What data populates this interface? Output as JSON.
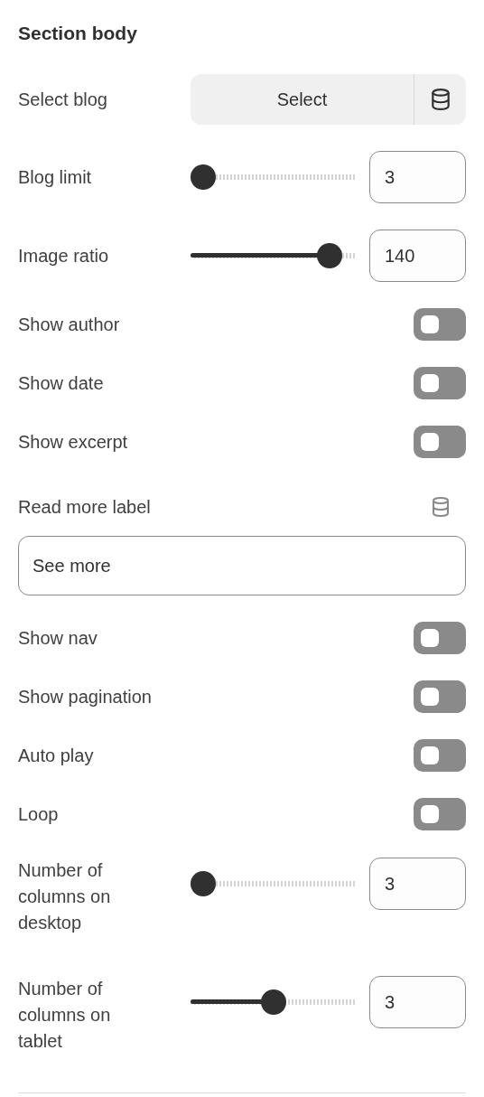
{
  "section_title": "Section body",
  "settings": [
    {
      "kind": "select",
      "label": "Select blog",
      "button": "Select"
    },
    {
      "kind": "slider",
      "label": "Blog limit",
      "level": 0,
      "value": "3"
    },
    {
      "kind": "slider",
      "label": "Image ratio",
      "level": 0.9,
      "value": "140"
    },
    {
      "kind": "toggle",
      "label": "Show author",
      "on": false
    },
    {
      "kind": "toggle",
      "label": "Show date",
      "on": false
    },
    {
      "kind": "toggle",
      "label": "Show excerpt",
      "on": false
    },
    {
      "kind": "text",
      "label": "Read more label",
      "value": "See more"
    },
    {
      "kind": "toggle",
      "label": "Show nav",
      "on": false
    },
    {
      "kind": "toggle",
      "label": "Show pagination",
      "on": false
    },
    {
      "kind": "toggle",
      "label": "Auto play",
      "on": false
    },
    {
      "kind": "toggle",
      "label": "Loop",
      "on": false
    },
    {
      "kind": "slider",
      "label": "Number of columns on desktop",
      "level": 0,
      "value": "3"
    },
    {
      "kind": "slider",
      "label": "Number of columns on tablet",
      "level": 0.5,
      "value": "3"
    }
  ]
}
